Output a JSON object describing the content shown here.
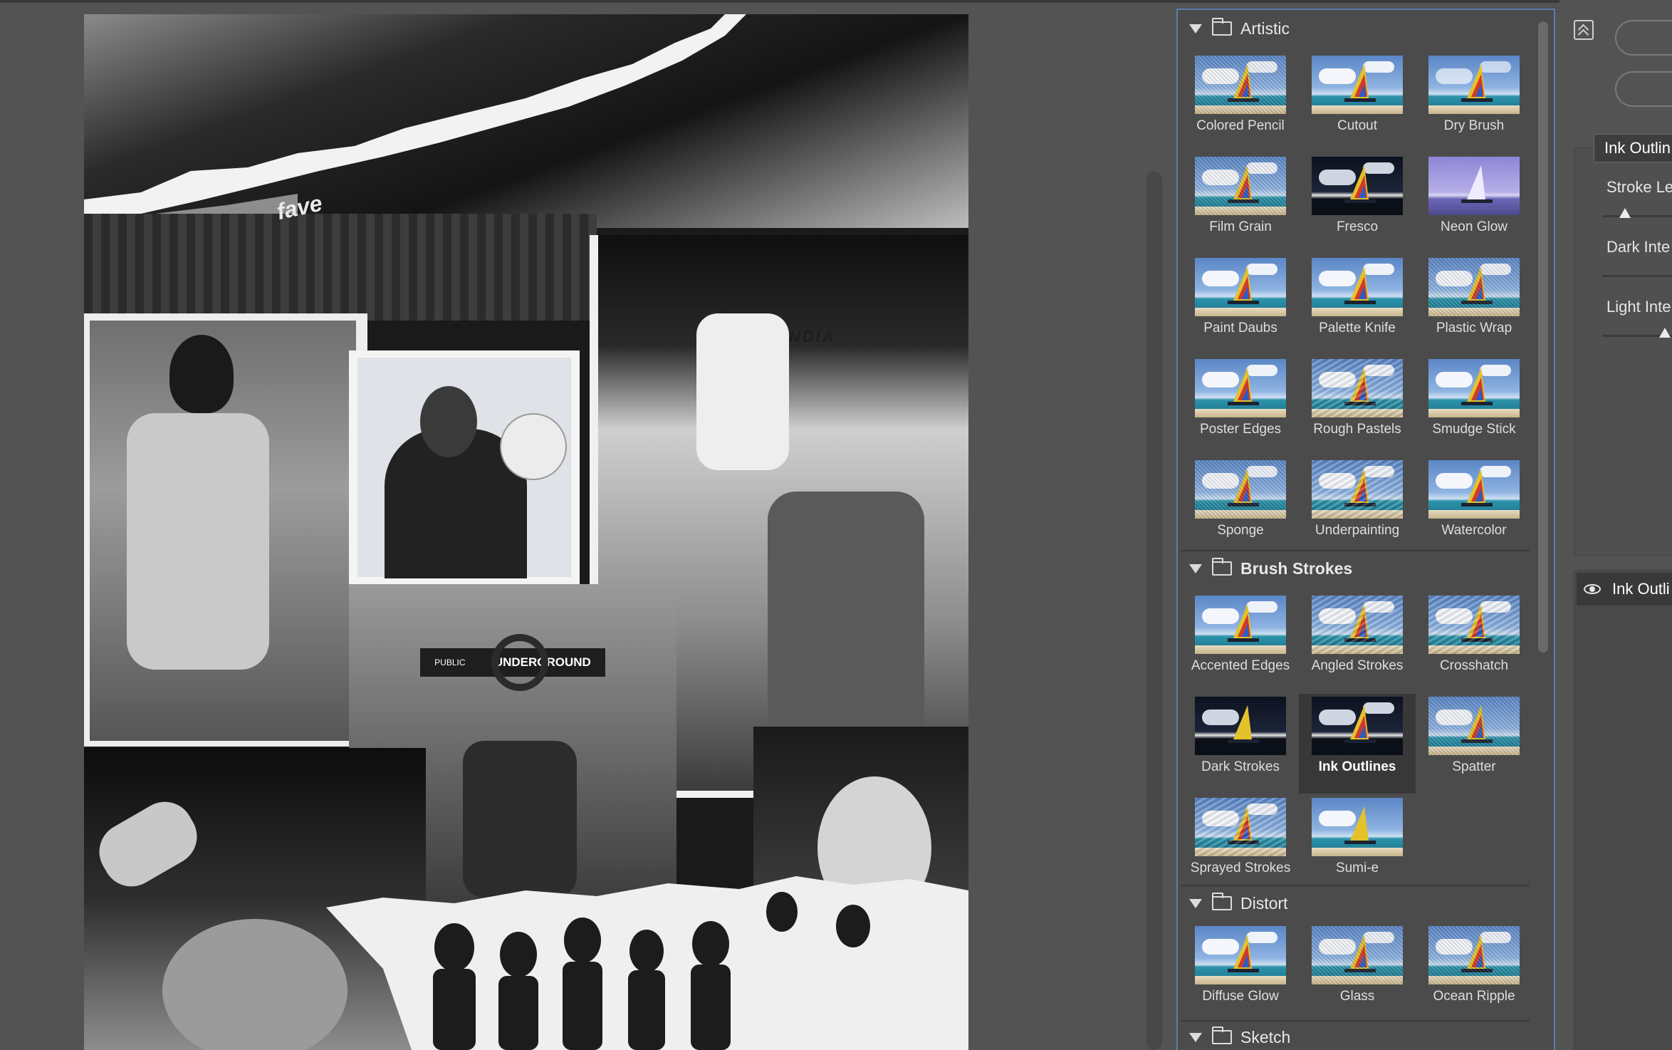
{
  "preview": {
    "poster_texts": [
      "fave",
      "PUBLIC",
      "UNDERGROUND",
      "NDIA"
    ]
  },
  "gallery": {
    "categories": [
      {
        "name": "Artistic",
        "filters": [
          "Colored Pencil",
          "Cutout",
          "Dry Brush",
          "Film Grain",
          "Fresco",
          "Neon Glow",
          "Paint Daubs",
          "Palette Knife",
          "Plastic Wrap",
          "Poster Edges",
          "Rough Pastels",
          "Smudge Stick",
          "Sponge",
          "Underpainting",
          "Watercolor"
        ]
      },
      {
        "name": "Brush Strokes",
        "filters": [
          "Accented Edges",
          "Angled Strokes",
          "Crosshatch",
          "Dark Strokes",
          "Ink Outlines",
          "Spatter",
          "Sprayed Strokes",
          "Sumi-e"
        ]
      },
      {
        "name": "Distort",
        "filters": [
          "Diffuse Glow",
          "Glass",
          "Ocean Ripple"
        ]
      },
      {
        "name": "Sketch",
        "filters": []
      }
    ],
    "selected_filter": "Ink Outlines"
  },
  "settings": {
    "filter_dropdown": "Ink Outlin",
    "params": [
      {
        "label": "Stroke Le",
        "value_fraction": 0.25
      },
      {
        "label": "Dark Inte",
        "value_fraction": null
      },
      {
        "label": "Light Inte",
        "value_fraction": 0.9
      }
    ],
    "layer_label": "Ink Outli"
  },
  "icons": {
    "collapse": "chevrons-up-icon",
    "folder": "folder-icon",
    "disclosure": "triangle-down-icon",
    "visibility": "eye-icon"
  },
  "colors": {
    "selection_border": "#5a7db0",
    "selected_thumb_bg": "#383838"
  }
}
